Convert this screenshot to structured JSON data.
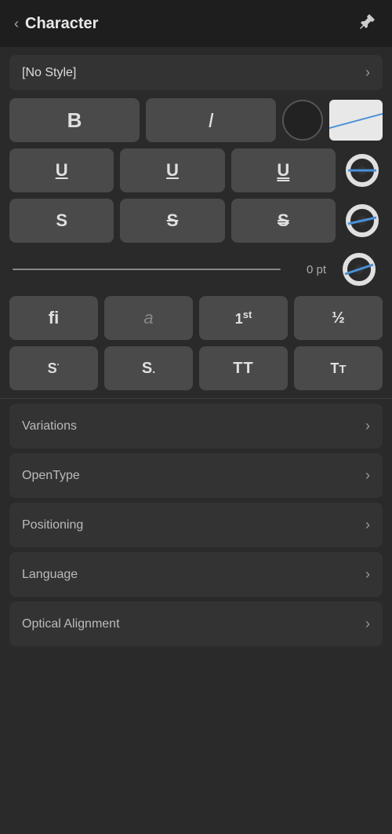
{
  "header": {
    "back_label": "‹",
    "title": "Character",
    "pin_label": "⊕"
  },
  "style_row": {
    "label": "[No Style]",
    "chevron": "›"
  },
  "formatting": {
    "bold": "B",
    "italic": "I",
    "underline1": "U",
    "underline2": "U",
    "underline3": "U",
    "strike1": "S",
    "strike2": "S",
    "strike3": "S",
    "baseline_value": "0 pt"
  },
  "typography": {
    "fi": "fi",
    "italic_a": "a",
    "superscript": "1st",
    "fraction": "½",
    "sup_dot": "S·",
    "period": "S.",
    "tt": "TT",
    "tt_small": "Tt"
  },
  "sections": [
    {
      "label": "Variations",
      "chevron": "›"
    },
    {
      "label": "OpenType",
      "chevron": "›"
    },
    {
      "label": "Positioning",
      "chevron": "›"
    },
    {
      "label": "Language",
      "chevron": "›"
    },
    {
      "label": "Optical Alignment",
      "chevron": "›"
    }
  ]
}
